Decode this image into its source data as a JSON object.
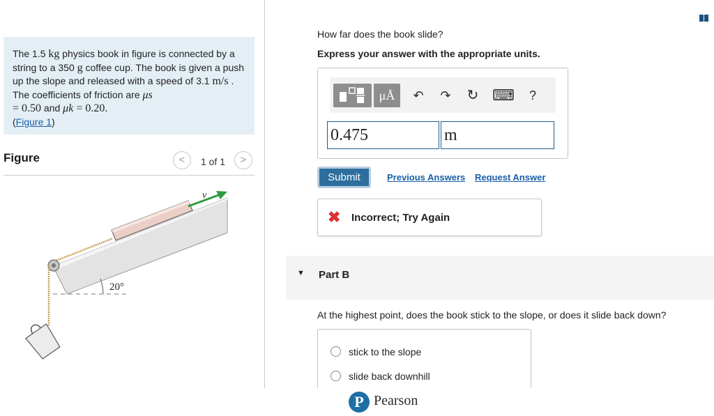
{
  "problem": {
    "text_1": "The 1.5 ",
    "mass_unit": "kg",
    "text_2": " physics book in figure is connected by a string to a 350 ",
    "mass2_unit": "g",
    "text_3": " coffee cup. The book is given a push up the slope and released with a speed of 3.1 ",
    "speed_unit": "m/s",
    "text_4": " . The coefficients of friction are ",
    "mu_s": "μs",
    "eq_1": "= 0.50",
    "text_5": " and ",
    "mu_k": "μk",
    "eq_2": " = 0.20.",
    "figure_link": "Figure 1"
  },
  "figure": {
    "title": "Figure",
    "pager": "1 of 1",
    "prev": "<",
    "next": ">",
    "angle_label": "20°",
    "velocity_label": "v⃗"
  },
  "part_a": {
    "question": "How far does the book slide?",
    "instruction": "Express your answer with the appropriate units.",
    "toolbar": {
      "mu_button": "μÅ",
      "undo": "↶",
      "redo": "↷",
      "reset": "↻",
      "keyboard": "⌨",
      "help": "?"
    },
    "value": "0.475",
    "unit": "m",
    "submit": "Submit",
    "previous_answers": "Previous Answers",
    "request_answer": "Request Answer",
    "feedback": "Incorrect; Try Again"
  },
  "part_b": {
    "title": "Part B",
    "question": "At the highest point, does the book stick to the slope, or does it slide back down?",
    "options": [
      "stick to the slope",
      "slide back downhill"
    ]
  },
  "footer": {
    "brand": "Pearson",
    "logo_letter": "P"
  },
  "colors": {
    "accent": "#2d6e9e",
    "link": "#1a5fa8",
    "error": "#dd3333",
    "problem_bg": "#e4eff5"
  }
}
